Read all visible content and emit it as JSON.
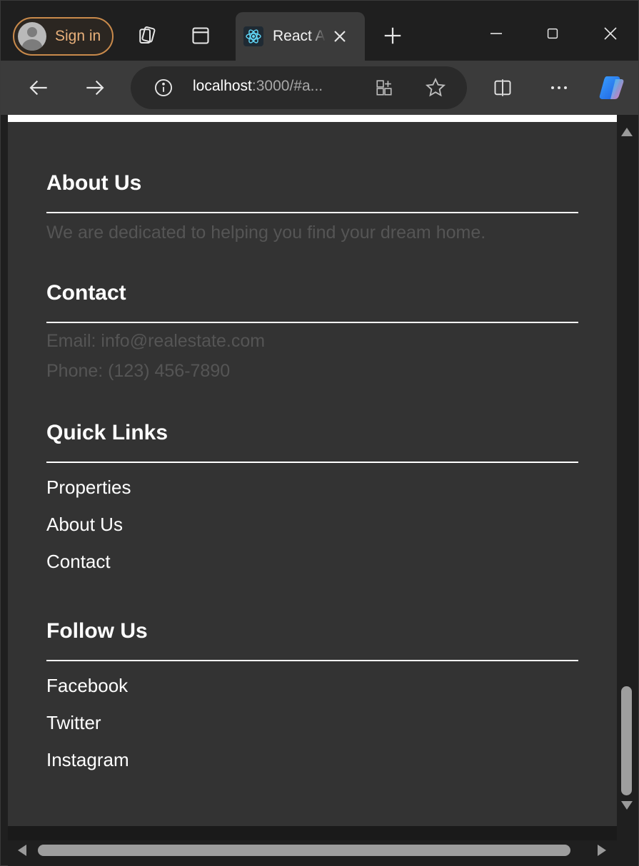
{
  "browser": {
    "signin_label": "Sign in",
    "tab_title": "React App",
    "url_host": "localhost",
    "url_rest": ":3000/#a..."
  },
  "footer": {
    "about": {
      "heading": "About Us",
      "text": "We are dedicated to helping you find your dream home."
    },
    "contact": {
      "heading": "Contact",
      "email": "Email: info@realestate.com",
      "phone": "Phone: (123) 456-7890"
    },
    "quick_links": {
      "heading": "Quick Links",
      "items": [
        "Properties",
        "About Us",
        "Contact"
      ]
    },
    "follow": {
      "heading": "Follow Us",
      "items": [
        "Facebook",
        "Twitter",
        "Instagram"
      ]
    }
  },
  "colors": {
    "page_bg": "#333333",
    "muted_text": "#555555",
    "signin_accent": "#e8b07a"
  },
  "icons": {
    "collections": "collections-icon",
    "tab_actions": "tab-actions-icon",
    "favicon": "react-logo-icon",
    "close_tab": "close-icon",
    "new_tab": "plus-icon",
    "back": "arrow-left-icon",
    "forward": "arrow-right-icon",
    "site_info": "info-icon",
    "apps": "apps-icon",
    "favorite": "star-icon",
    "split_screen": "split-screen-icon",
    "more": "more-icon",
    "copilot": "copilot-icon"
  }
}
